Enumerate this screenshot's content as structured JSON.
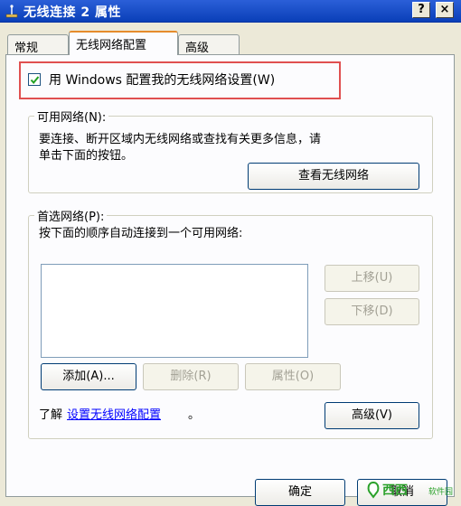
{
  "window": {
    "title": "无线连接 2 属性",
    "help_label": "?",
    "close_label": "×"
  },
  "tabs": [
    {
      "label": "常规"
    },
    {
      "label": "无线网络配置"
    },
    {
      "label": "高级"
    }
  ],
  "config": {
    "checkbox_label": "用 Windows 配置我的无线网络设置(W)",
    "checked": true
  },
  "available": {
    "legend": "可用网络(N):",
    "description_line1": "要连接、断开区域内无线网络或查找有关更多信息，请",
    "description_line2": "单击下面的按钮。",
    "view_button": "查看无线网络"
  },
  "preferred": {
    "legend": "首选网络(P):",
    "description": "按下面的顺序自动连接到一个可用网络:",
    "move_up": "上移(U)",
    "move_down": "下移(D)",
    "add": "添加(A)...",
    "remove": "删除(R)",
    "properties": "属性(O)"
  },
  "footer": {
    "learn_prefix": "了解",
    "learn_link": "设置无线网络配置",
    "learn_suffix": "。",
    "advanced_button": "高级(V)"
  },
  "bottom": {
    "ok": "确定",
    "cancel": "取消"
  },
  "watermark": {
    "text": "西西",
    "sub": "软件园"
  },
  "colors": {
    "title_bar": "#0a3fb8",
    "highlight_box": "#e05050",
    "active_tab_accent": "#e68b2c"
  }
}
